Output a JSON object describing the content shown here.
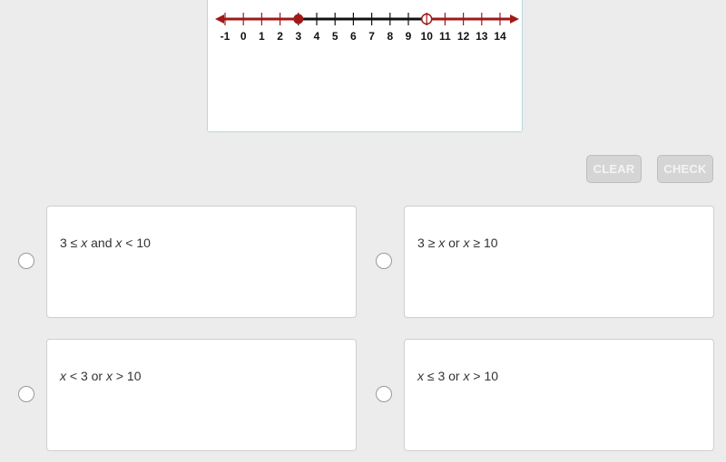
{
  "number_line": {
    "min": -1,
    "max": 14,
    "ticks": [
      "-1",
      "0",
      "1",
      "2",
      "3",
      "4",
      "5",
      "6",
      "7",
      "8",
      "9",
      "10",
      "11",
      "12",
      "13",
      "14"
    ],
    "closed_point": 3,
    "open_point": 10,
    "shaded_color": "#a01818",
    "unshaded_color": "#111111",
    "shaded_regions": [
      "x <= 3 (arrow left)",
      "x > 10 (arrow right)"
    ]
  },
  "buttons": {
    "clear_label": "CLEAR",
    "check_label": "CHECK"
  },
  "options": [
    {
      "id": "a",
      "parts": [
        "3 ≤ ",
        "x",
        " and ",
        "x",
        " < 10"
      ],
      "selected": false
    },
    {
      "id": "b",
      "parts": [
        "3 ≥ ",
        "x",
        " or ",
        "x",
        " ≥ 10"
      ],
      "selected": false
    },
    {
      "id": "c",
      "parts": [
        "",
        "x",
        " < 3 or ",
        "x",
        " > 10"
      ],
      "selected": false
    },
    {
      "id": "d",
      "parts": [
        "",
        "x",
        " ≤ 3 or ",
        "x",
        " > 10"
      ],
      "selected": false
    }
  ]
}
